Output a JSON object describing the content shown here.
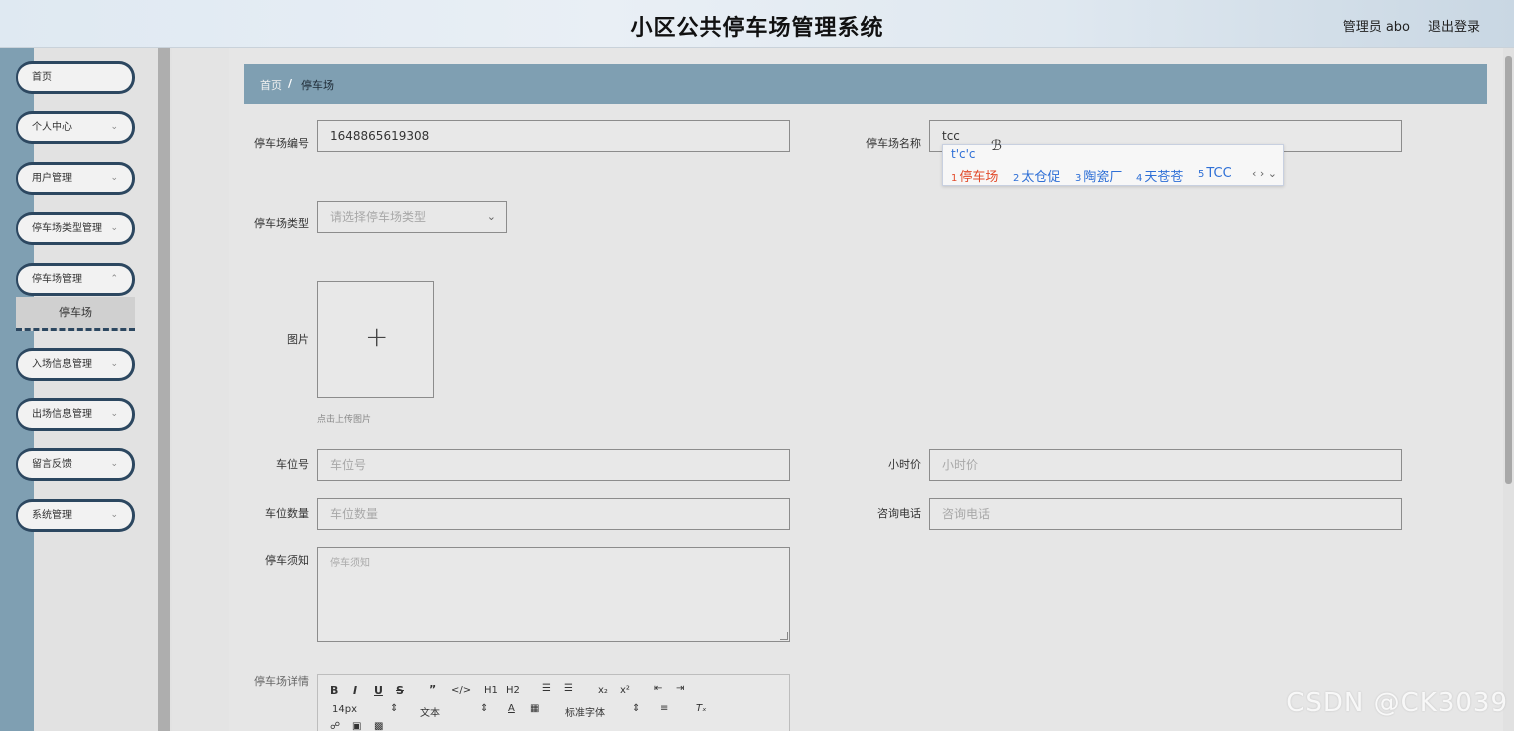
{
  "header": {
    "title": "小区公共停车场管理系统",
    "user": "管理员 abo",
    "logout": "退出登录"
  },
  "sidebar": {
    "items": [
      {
        "label": "首页",
        "has_children": false
      },
      {
        "label": "个人中心",
        "has_children": true
      },
      {
        "label": "用户管理",
        "has_children": true
      },
      {
        "label": "停车场类型管理",
        "has_children": true
      },
      {
        "label": "停车场管理",
        "has_children": true
      },
      {
        "label": "入场信息管理",
        "has_children": true
      },
      {
        "label": "出场信息管理",
        "has_children": true
      },
      {
        "label": "留言反馈",
        "has_children": true
      },
      {
        "label": "系统管理",
        "has_children": true
      }
    ],
    "active_sub": "停车场"
  },
  "breadcrumb": {
    "home": "首页",
    "sep": "/",
    "current": "停车场"
  },
  "form": {
    "lot_number": {
      "label": "停车场编号",
      "value": "1648865619308"
    },
    "lot_name": {
      "label": "停车场名称",
      "value": "tcc"
    },
    "lot_type": {
      "label": "停车场类型",
      "placeholder": "请选择停车场类型"
    },
    "image": {
      "label": "图片",
      "hint": "点击上传图片",
      "plus": "+"
    },
    "space_no": {
      "label": "车位号",
      "placeholder": "车位号"
    },
    "hourly_price": {
      "label": "小时价",
      "placeholder": "小时价"
    },
    "space_count": {
      "label": "车位数量",
      "placeholder": "车位数量"
    },
    "phone": {
      "label": "咨询电话",
      "placeholder": "咨询电话"
    },
    "notice": {
      "label": "停车须知",
      "placeholder": "停车须知"
    },
    "details": {
      "label": "停车场详情"
    }
  },
  "editor": {
    "font_size": "14px",
    "text_style": "文本",
    "font_family": "标准字体"
  },
  "ime": {
    "composition": "t'c'c",
    "candidates": [
      {
        "num": "1",
        "text": "停车场"
      },
      {
        "num": "2",
        "text": "太仓促"
      },
      {
        "num": "3",
        "text": "陶瓷厂"
      },
      {
        "num": "4",
        "text": "天苍苍"
      },
      {
        "num": "5",
        "text": "TCC"
      }
    ]
  },
  "watermark": "CSDN @CK3039"
}
